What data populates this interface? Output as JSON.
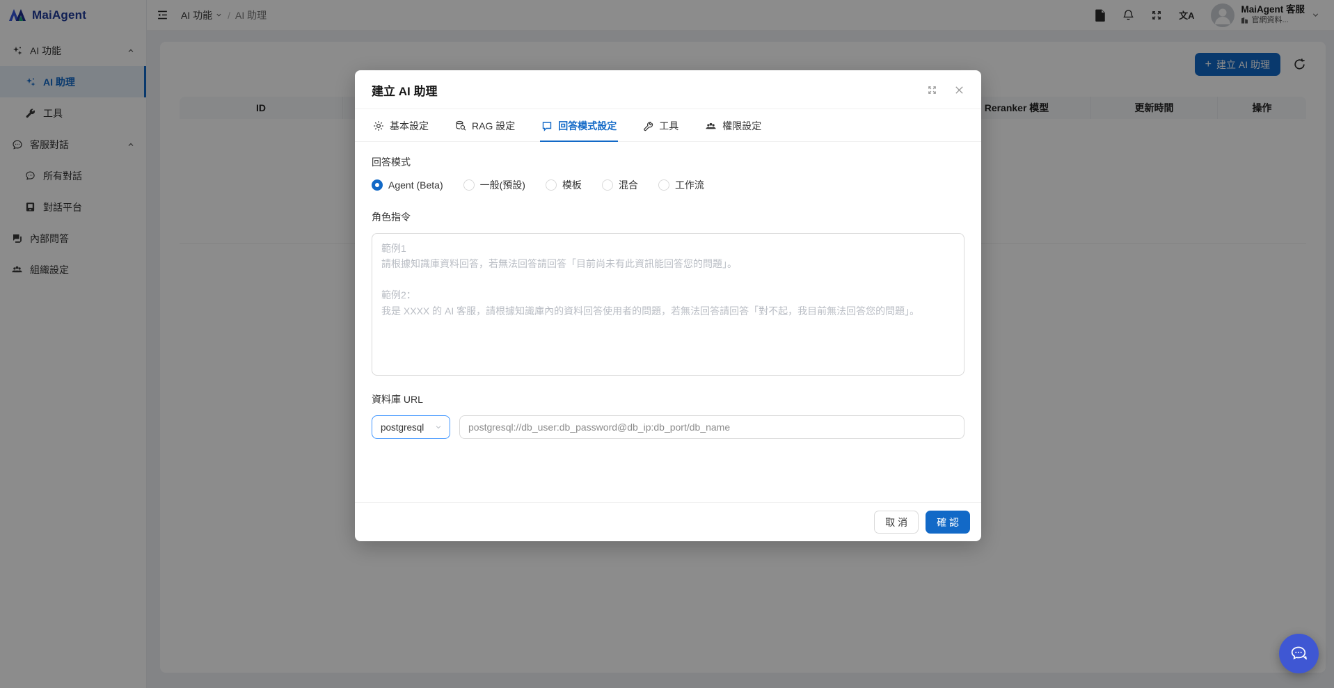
{
  "colors": {
    "primary": "#1269c7",
    "select_focus_border": "#4096ff",
    "sidebar_active_bg": "#e6eef8",
    "chat_fab": "#3f57d3",
    "mask": "rgba(0,0,0,0.45)"
  },
  "sidebar": {
    "logo": "MaiAgent",
    "items": [
      {
        "label": "AI 功能"
      },
      {
        "label": "AI 助理"
      },
      {
        "label": "工具"
      },
      {
        "label": "客服對話"
      },
      {
        "label": "所有對話"
      },
      {
        "label": "對話平台"
      },
      {
        "label": "內部問答"
      },
      {
        "label": "組織設定"
      }
    ]
  },
  "header": {
    "breadcrumb": {
      "parent": "AI 功能",
      "separator": "/",
      "current": "AI 助理"
    },
    "translate_icon_text": "文A",
    "user": {
      "name": "MaiAgent 客服",
      "subtitle": "官網資料..."
    }
  },
  "content": {
    "create_button": "建立 AI 助理",
    "plus_icon": "+",
    "table": {
      "columns": [
        "ID",
        "Reranker 模型",
        "更新時間",
        "操作"
      ]
    }
  },
  "modal": {
    "title": "建立 AI 助理",
    "tabs": [
      {
        "label": "基本設定"
      },
      {
        "label": "RAG 設定"
      },
      {
        "label": "回答模式設定",
        "active": true
      },
      {
        "label": "工具"
      },
      {
        "label": "權限設定"
      }
    ],
    "answer_mode": {
      "label": "回答模式",
      "options": [
        {
          "label": "Agent (Beta)",
          "selected": true
        },
        {
          "label": "一般(預設)",
          "selected": false
        },
        {
          "label": "模板",
          "selected": false
        },
        {
          "label": "混合",
          "selected": false
        },
        {
          "label": "工作流",
          "selected": false
        }
      ]
    },
    "role": {
      "label": "角色指令",
      "placeholder": "範例1\n請根據知識庫資料回答，若無法回答請回答「目前尚未有此資訊能回答您的問題」。\n\n範例2：\n我是 XXXX 的 AI 客服，請根據知識庫內的資料回答使用者的問題，若無法回答請回答「對不起，我目前無法回答您的問題」。"
    },
    "database": {
      "label": "資料庫 URL",
      "select_value": "postgresql",
      "url_placeholder": "postgresql://db_user:db_password@db_ip:db_port/db_name"
    },
    "footer": {
      "cancel": "取 消",
      "confirm": "確 認"
    }
  }
}
